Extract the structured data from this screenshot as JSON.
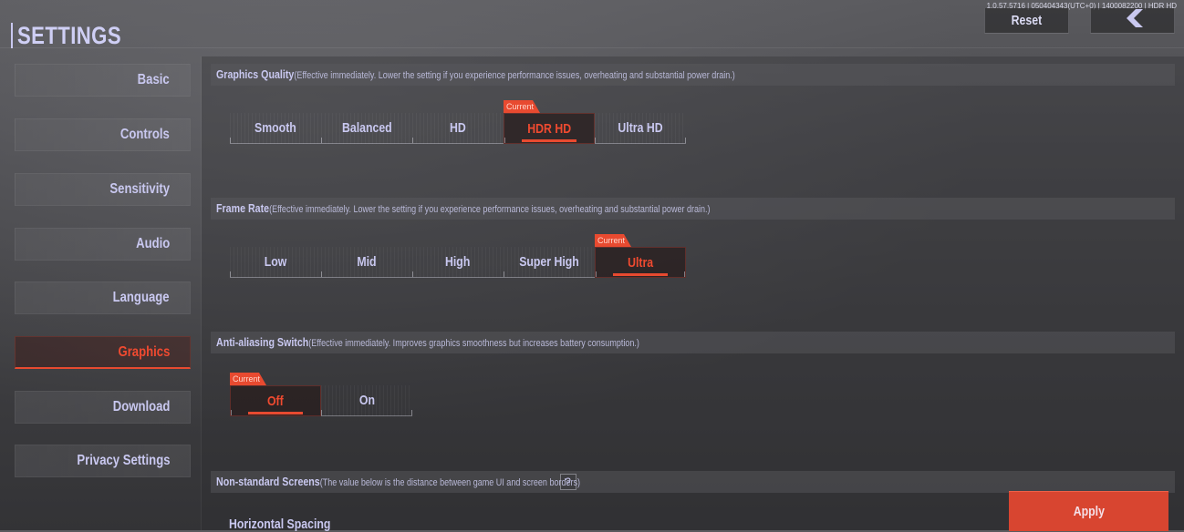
{
  "header": {
    "title": "SETTINGS",
    "version": "1.0.57.5716 | 050404343(UTC+0) | 1400082200 | HDR HD",
    "reset_label": "Reset",
    "back_icon": "chevron-left-icon"
  },
  "sidebar": {
    "items": [
      {
        "label": "Basic",
        "active": false
      },
      {
        "label": "Controls",
        "active": false
      },
      {
        "label": "Sensitivity",
        "active": false
      },
      {
        "label": "Audio",
        "active": false
      },
      {
        "label": "Language",
        "active": false
      },
      {
        "label": "Graphics",
        "active": true
      },
      {
        "label": "Download",
        "active": false
      },
      {
        "label": "Privacy Settings",
        "active": false
      }
    ]
  },
  "sections": {
    "graphics_quality": {
      "title": "Graphics Quality",
      "description": "(Effective immediately. Lower the setting if you experience performance issues, overheating and substantial power drain.)",
      "options": [
        "Smooth",
        "Balanced",
        "HD",
        "HDR HD",
        "Ultra HD"
      ],
      "selected": "HDR HD",
      "current_tag": "Current"
    },
    "frame_rate": {
      "title": "Frame Rate",
      "description": "(Effective immediately. Lower the setting if you experience performance issues, overheating and substantial power drain.)",
      "options": [
        "Low",
        "Mid",
        "High",
        "Super High",
        "Ultra"
      ],
      "selected": "Ultra",
      "current_tag": "Current"
    },
    "anti_aliasing": {
      "title": "Anti-aliasing Switch",
      "description": "(Effective immediately. Improves graphics smoothness but increases battery consumption.)",
      "options": [
        "Off",
        "On"
      ],
      "selected": "Off",
      "current_tag": "Current"
    },
    "non_standard_screens": {
      "title": "Non-standard Screens",
      "description": "(The value below is the distance between game UI and screen borders)",
      "help_label": "?",
      "sub_label": "Horizontal Spacing"
    }
  },
  "footer": {
    "apply_label": "Apply"
  },
  "colors": {
    "accent": "#e84a30",
    "text": "#c9c8f0",
    "apply_bg": "#d84530"
  }
}
